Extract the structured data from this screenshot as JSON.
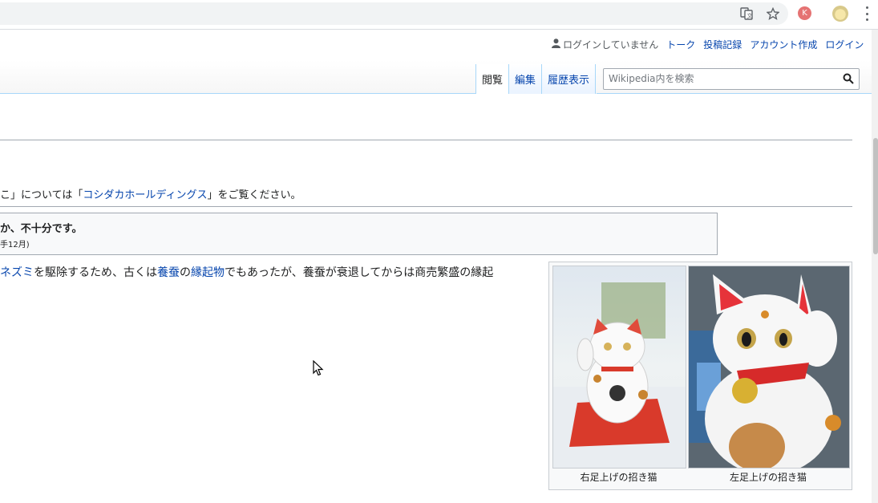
{
  "browser": {
    "icons": [
      "translate-icon",
      "star-icon"
    ],
    "profile_initial": "K"
  },
  "personal": {
    "not_logged_in": "ログインしていません",
    "talk": "トーク",
    "contributions": "投稿記録",
    "create_account": "アカウント作成",
    "login": "ログイン"
  },
  "tabs": [
    {
      "label": "閲覧",
      "selected": true
    },
    {
      "label": "編集",
      "selected": false
    },
    {
      "label": "履歴表示",
      "selected": false
    }
  ],
  "search": {
    "placeholder": "Wikipedia内を検索"
  },
  "hatnote": {
    "pre": "こ」については「",
    "link": "コシダカホールディングス",
    "post": "」をご覧ください。"
  },
  "ambox": {
    "title": "か、不十分です。",
    "date": "手12月)"
  },
  "body": {
    "p1": "ネズミ",
    "p2": "を駆除するため、古くは",
    "p3": "養蚕",
    "p4": "の",
    "p5": "縁起物",
    "p6": "でもあったが、養蚕が衰退してからは商売繁盛の縁起"
  },
  "gallery": {
    "caption_right": "右足上げの招き猫",
    "caption_left": "左足上げの招き猫"
  },
  "colors": {
    "link": "#0645ad",
    "tab_border": "#a7d7f9"
  }
}
